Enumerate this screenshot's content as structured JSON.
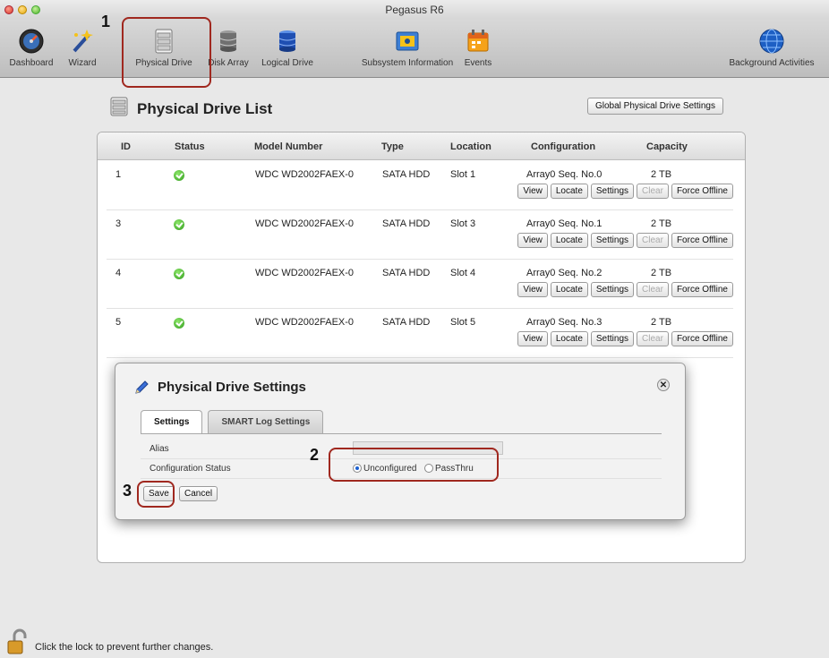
{
  "window": {
    "title": "Pegasus R6"
  },
  "toolbar": {
    "items": [
      {
        "label": "Dashboard",
        "icon": "dashboard-gauge-icon"
      },
      {
        "label": "Wizard",
        "icon": "wizard-wand-icon"
      },
      {
        "label": "Physical Drive",
        "icon": "physical-drive-icon"
      },
      {
        "label": "Disk Array",
        "icon": "disk-array-icon"
      },
      {
        "label": "Logical Drive",
        "icon": "logical-drive-icon"
      },
      {
        "label": "Subsystem Information",
        "icon": "subsystem-info-icon"
      },
      {
        "label": "Events",
        "icon": "events-calendar-icon"
      },
      {
        "label": "Background Activities",
        "icon": "background-activities-globe-icon"
      }
    ]
  },
  "page": {
    "title": "Physical Drive List",
    "global_settings_button": "Global Physical Drive Settings"
  },
  "table": {
    "columns": [
      "ID",
      "Status",
      "Model Number",
      "Type",
      "Location",
      "Configuration",
      "Capacity"
    ],
    "rows": [
      {
        "id": "1",
        "model": "WDC WD2002FAEX-0",
        "type": "SATA HDD",
        "location": "Slot 1",
        "configuration": "Array0 Seq. No.0",
        "capacity": "2 TB"
      },
      {
        "id": "3",
        "model": "WDC WD2002FAEX-0",
        "type": "SATA HDD",
        "location": "Slot 3",
        "configuration": "Array0 Seq. No.1",
        "capacity": "2 TB"
      },
      {
        "id": "4",
        "model": "WDC WD2002FAEX-0",
        "type": "SATA HDD",
        "location": "Slot 4",
        "configuration": "Array0 Seq. No.2",
        "capacity": "2 TB"
      },
      {
        "id": "5",
        "model": "WDC WD2002FAEX-0",
        "type": "SATA HDD",
        "location": "Slot 5",
        "configuration": "Array0 Seq. No.3",
        "capacity": "2 TB"
      }
    ],
    "row_actions": {
      "view": "View",
      "locate": "Locate",
      "settings": "Settings",
      "clear": "Clear",
      "force_offline": "Force Offline"
    }
  },
  "dialog": {
    "title": "Physical Drive Settings",
    "tabs": [
      {
        "label": "Settings",
        "active": true
      },
      {
        "label": "SMART Log Settings",
        "active": false
      }
    ],
    "alias_label": "Alias",
    "alias_value": "",
    "config_status_label": "Configuration Status",
    "options": [
      {
        "label": "Unconfigured",
        "selected": true
      },
      {
        "label": "PassThru",
        "selected": false
      }
    ],
    "save_label": "Save",
    "cancel_label": "Cancel"
  },
  "callouts": {
    "one": "1",
    "two": "2",
    "three": "3"
  },
  "footer": {
    "lock_text": "Click the lock to prevent further changes."
  },
  "colors": {
    "callout_border": "#a0281f",
    "status_ok": "#2f9a1a"
  }
}
